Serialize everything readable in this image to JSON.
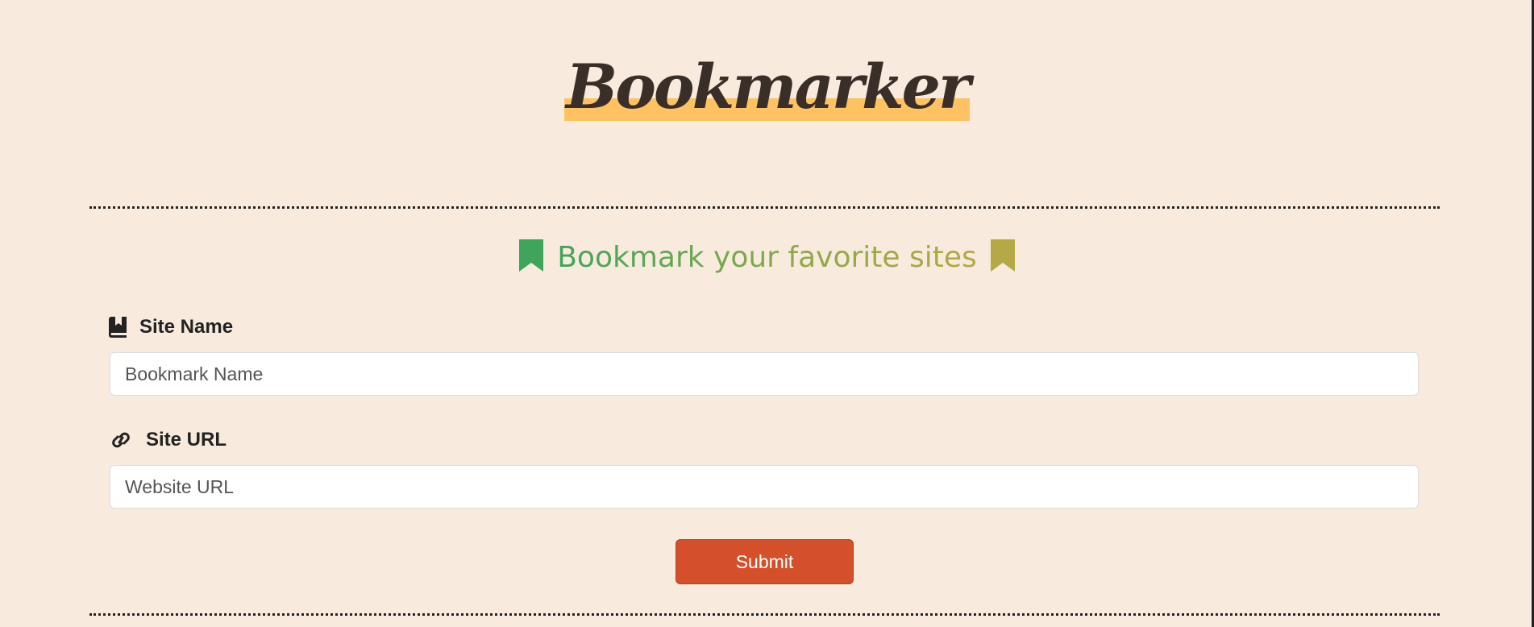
{
  "header": {
    "title": "Bookmarker",
    "highlight_color": "#ffc263"
  },
  "form": {
    "subtitle": "Bookmark your favorite sites",
    "subtitle_left_icon": "bookmark-icon",
    "subtitle_right_icon": "bookmark-icon",
    "subtitle_colors": [
      "#3fa55b",
      "#b5a846"
    ],
    "site_name": {
      "label": "Site Name",
      "icon": "book-bookmark-icon",
      "placeholder": "Bookmark Name",
      "value": ""
    },
    "site_url": {
      "label": "Site URL",
      "icon": "link-icon",
      "placeholder": "Website URL",
      "value": ""
    },
    "submit_label": "Submit",
    "submit_color": "#d3502b"
  },
  "theme": {
    "background": "#f8ebdd"
  }
}
